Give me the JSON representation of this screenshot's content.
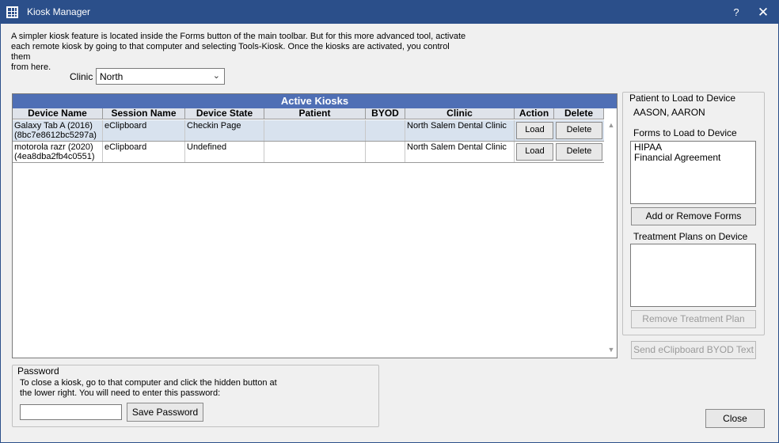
{
  "window": {
    "title": "Kiosk Manager",
    "help": "?",
    "close": "✕"
  },
  "intro": {
    "lines": [
      "A simpler kiosk feature is located inside the Forms button of the main toolbar.  But for this more advanced tool, activate",
      "each remote kiosk by going to that computer and selecting Tools-Kiosk.  Once the kiosks are activated, you control them",
      "from here."
    ]
  },
  "clinic": {
    "label": "Clinic",
    "value": "North",
    "chevron": "⌄"
  },
  "grid": {
    "title": "Active Kiosks",
    "columns": [
      "Device Name",
      "Session Name",
      "Device State",
      "Patient",
      "BYOD",
      "Clinic",
      "Action",
      "Delete"
    ],
    "rows": [
      {
        "device_line1": "Galaxy Tab A (2016)",
        "device_line2": "(8bc7e8612bc5297a)",
        "session": "eClipboard",
        "state": "Checkin Page",
        "patient": "",
        "byod": "",
        "clinic": "North Salem Dental Clinic",
        "action": "Load",
        "delete": "Delete",
        "selected": true
      },
      {
        "device_line1": "motorola razr (2020)",
        "device_line2": "(4ea8dba2fb4c0551)",
        "session": "eClipboard",
        "state": "Undefined",
        "patient": "",
        "byod": "",
        "clinic": "North Salem Dental Clinic",
        "action": "Load",
        "delete": "Delete",
        "selected": false
      }
    ],
    "scroll_up": "▲",
    "scroll_down": "▼"
  },
  "right_panel": {
    "title": "Patient to Load to Device",
    "patient_name": "AASON, AARON",
    "forms_label": "Forms to Load to Device",
    "forms": [
      "HIPAA",
      "Financial Agreement"
    ],
    "add_remove_forms": "Add or Remove Forms",
    "treatment_plans_label": "Treatment Plans on Device",
    "remove_treatment_plan": "Remove Treatment Plan",
    "send_byod": "Send eClipboard BYOD Text"
  },
  "password": {
    "title": "Password",
    "desc_lines": [
      "To close a kiosk, go to that computer and click the hidden button at",
      "the lower right.  You will need to enter this password:"
    ],
    "value": "",
    "save_button": "Save Password"
  },
  "close_button": "Close",
  "colors": {
    "titlebar": "#2b4f8a",
    "grid_title": "#4f6fb5",
    "selected_row": "#d8e2ee"
  }
}
